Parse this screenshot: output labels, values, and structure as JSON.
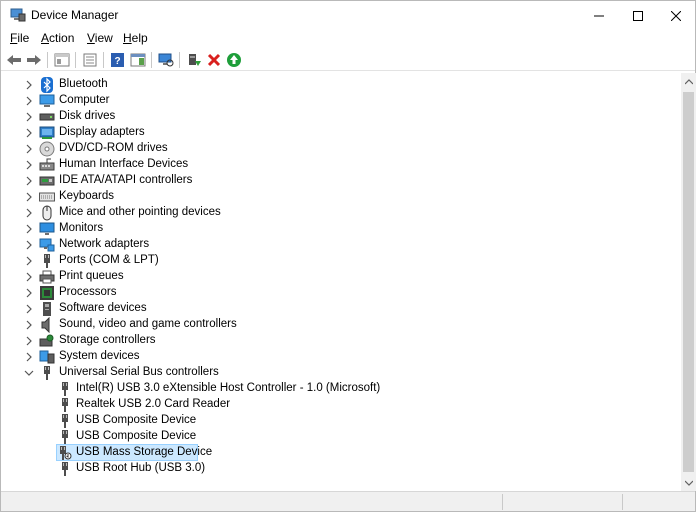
{
  "window": {
    "title": "Device Manager"
  },
  "menu": [
    {
      "label": "File",
      "accel": "F",
      "rest": "ile"
    },
    {
      "label": "Action",
      "accel": "A",
      "rest": "ction"
    },
    {
      "label": "View",
      "accel": "V",
      "rest": "iew"
    },
    {
      "label": "Help",
      "accel": "H",
      "rest": "elp"
    }
  ],
  "toolbar": {
    "icons": [
      "back-icon",
      "forward-icon",
      "properties-pane-icon",
      "properties-icon",
      "help-icon",
      "action-pane-icon",
      "scan-hardware-icon",
      "update-driver-icon",
      "uninstall-icon",
      "enable-device-icon"
    ]
  },
  "tree": {
    "categories": [
      {
        "label": "Bluetooth",
        "icon": "bluetooth-icon",
        "expanded": false
      },
      {
        "label": "Computer",
        "icon": "computer-icon",
        "expanded": false
      },
      {
        "label": "Disk drives",
        "icon": "disk-drive-icon",
        "expanded": false
      },
      {
        "label": "Display adapters",
        "icon": "display-adapter-icon",
        "expanded": false
      },
      {
        "label": "DVD/CD-ROM drives",
        "icon": "dvd-icon",
        "expanded": false
      },
      {
        "label": "Human Interface Devices",
        "icon": "hid-icon",
        "expanded": false
      },
      {
        "label": "IDE ATA/ATAPI controllers",
        "icon": "ide-icon",
        "expanded": false
      },
      {
        "label": "Keyboards",
        "icon": "keyboard-icon",
        "expanded": false
      },
      {
        "label": "Mice and other pointing devices",
        "icon": "mouse-icon",
        "expanded": false
      },
      {
        "label": "Monitors",
        "icon": "monitor-icon",
        "expanded": false
      },
      {
        "label": "Network adapters",
        "icon": "network-icon",
        "expanded": false
      },
      {
        "label": "Ports (COM & LPT)",
        "icon": "port-icon",
        "expanded": false
      },
      {
        "label": "Print queues",
        "icon": "printer-icon",
        "expanded": false
      },
      {
        "label": "Processors",
        "icon": "processor-icon",
        "expanded": false
      },
      {
        "label": "Software devices",
        "icon": "software-device-icon",
        "expanded": false
      },
      {
        "label": "Sound, video and game controllers",
        "icon": "sound-icon",
        "expanded": false
      },
      {
        "label": "Storage controllers",
        "icon": "storage-controller-icon",
        "expanded": false
      },
      {
        "label": "System devices",
        "icon": "system-device-icon",
        "expanded": false
      },
      {
        "label": "Universal Serial Bus controllers",
        "icon": "usb-icon",
        "expanded": true
      }
    ],
    "usb_children": [
      {
        "label": "Intel(R) USB 3.0 eXtensible Host Controller - 1.0 (Microsoft)",
        "selected": false
      },
      {
        "label": "Realtek USB 2.0 Card Reader",
        "selected": false
      },
      {
        "label": "USB Composite Device",
        "selected": false
      },
      {
        "label": "USB Composite Device",
        "selected": false
      },
      {
        "label": "USB Mass Storage Device",
        "selected": true
      },
      {
        "label": "USB Root Hub (USB 3.0)",
        "selected": false
      }
    ]
  },
  "colors": {
    "selection": "#cce8ff",
    "selection_border": "#99d1ff"
  }
}
